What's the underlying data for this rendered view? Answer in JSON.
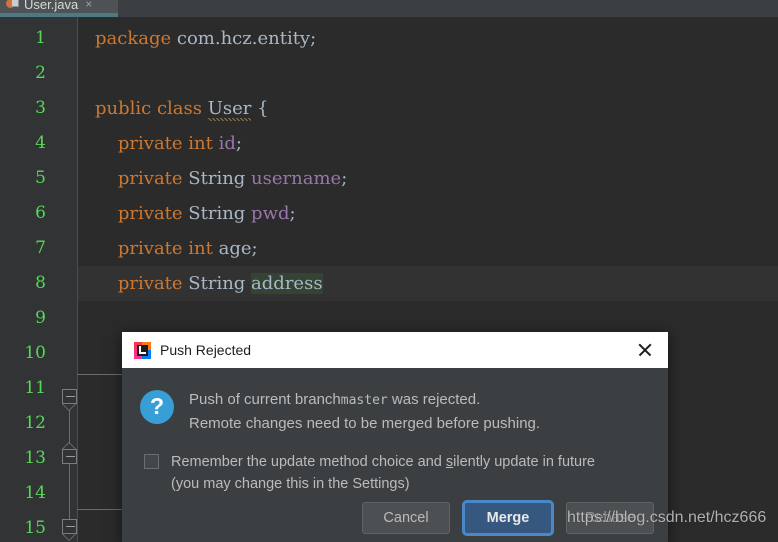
{
  "editor": {
    "tab": {
      "label": "User.java",
      "close_glyph": "×",
      "icon": "java-file-icon"
    },
    "line_numbers": [
      "1",
      "2",
      "3",
      "4",
      "5",
      "6",
      "7",
      "8",
      "9",
      "10",
      "11",
      "12",
      "13",
      "14",
      "15"
    ],
    "code_lines": [
      {
        "n": 1,
        "tokens": [
          {
            "t": "package",
            "c": "kw"
          },
          {
            "t": " com.hcz.entity;",
            "c": "txt"
          }
        ]
      },
      {
        "n": 2,
        "tokens": []
      },
      {
        "n": 3,
        "tokens": [
          {
            "t": "public class ",
            "c": "kw"
          },
          {
            "t": "User",
            "c": "warnu"
          },
          {
            "t": " {",
            "c": "brc"
          }
        ]
      },
      {
        "n": 4,
        "tokens": [
          {
            "t": "    private int ",
            "c": "kw"
          },
          {
            "t": "id",
            "c": "fld"
          },
          {
            "t": ";",
            "c": "punc"
          }
        ]
      },
      {
        "n": 5,
        "tokens": [
          {
            "t": "    private ",
            "c": "kw"
          },
          {
            "t": "String ",
            "c": "txt"
          },
          {
            "t": "username",
            "c": "fld"
          },
          {
            "t": ";",
            "c": "punc"
          }
        ]
      },
      {
        "n": 6,
        "tokens": [
          {
            "t": "    private ",
            "c": "kw"
          },
          {
            "t": "String ",
            "c": "txt"
          },
          {
            "t": "pwd",
            "c": "fld"
          },
          {
            "t": ";",
            "c": "punc"
          }
        ]
      },
      {
        "n": 7,
        "tokens": [
          {
            "t": "    private int ",
            "c": "kw"
          },
          {
            "t": "age",
            "c": "txt"
          },
          {
            "t": ";",
            "c": "punc"
          }
        ]
      },
      {
        "n": 8,
        "tokens": [
          {
            "t": "    private ",
            "c": "kw"
          },
          {
            "t": "String ",
            "c": "txt"
          },
          {
            "t": "address",
            "c": "selbg"
          }
        ]
      }
    ],
    "highlighted_line": 8,
    "selection_text": "address",
    "colors": {
      "background": "#2b2b2b",
      "gutter": "#313335",
      "line_number": "#55d955",
      "keyword": "#cc7832",
      "identifier": "#a9b7c6",
      "field": "#9876aa",
      "selection": "#344334",
      "tab_active_underline": "#4a7a82"
    }
  },
  "dialog": {
    "title": "Push Rejected",
    "title_icon": "intellij-idea-icon",
    "close_label": "close",
    "info_icon": "question-mark-icon",
    "message_lines": [
      {
        "pre": "Push of current branch",
        "mono": "master",
        "post": " was rejected."
      },
      {
        "pre": "Remote changes need to be merged before pushing.",
        "mono": "",
        "post": ""
      }
    ],
    "checkbox": {
      "checked": false,
      "line1_pre": "Remember the update method choice and ",
      "line1_mnemonic": "s",
      "line1_post": "ilently update in future",
      "line2": "(you may change this in the Settings)"
    },
    "buttons": [
      {
        "label": "Cancel",
        "style": "default"
      },
      {
        "label": "Merge",
        "style": "primary"
      },
      {
        "label": "Rebase",
        "style": "dim"
      }
    ],
    "colors": {
      "titlebar": "#ffffff",
      "body": "#3c3f41",
      "primary_button": "#365880",
      "focus_ring": "#4a88c7",
      "info_icon": "#389fd6"
    }
  },
  "watermark": {
    "text": "https://blog.csdn.net/hcz666"
  }
}
